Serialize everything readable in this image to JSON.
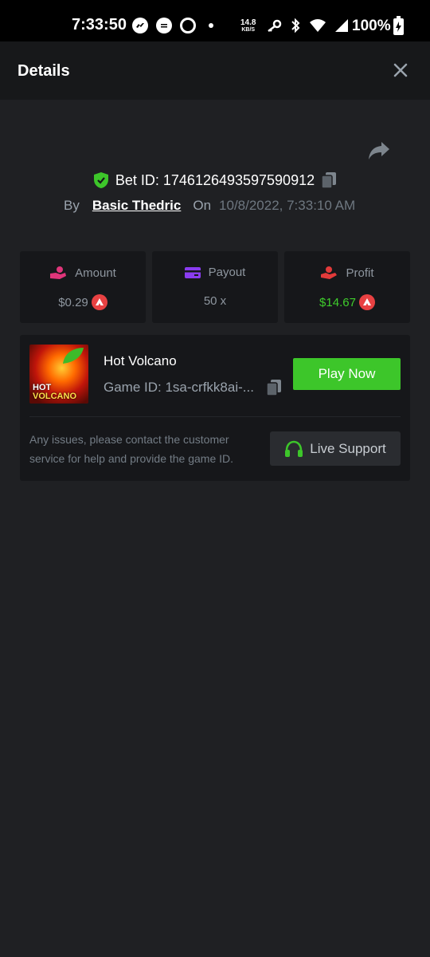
{
  "status_bar": {
    "time": "7:33:50",
    "net_speed_value": "14.8",
    "net_speed_unit": "KB/S",
    "battery": "100%",
    "messenger_icon": "messenger-icon",
    "chat_icon": "chat-bubble-icon",
    "ring_icon": "ring-icon",
    "key_icon": "key-icon",
    "bluetooth_icon": "bluetooth-icon",
    "wifi_icon": "wifi-icon",
    "signal_icon": "signal-icon",
    "battery_icon": "battery-charging-icon"
  },
  "header": {
    "title": "Details",
    "close_icon": "close-icon"
  },
  "bet": {
    "bet_id_text": "Bet ID: 1746126493597590912",
    "by_label": "By",
    "user": "Basic Thedric",
    "on_label": "On",
    "date": "10/8/2022, 7:33:10 AM"
  },
  "stats": {
    "amount": {
      "label": "Amount",
      "value": "$0.29"
    },
    "payout": {
      "label": "Payout",
      "value": "50 x"
    },
    "profit": {
      "label": "Profit",
      "value": "$14.67"
    }
  },
  "game": {
    "title": "Hot Volcano",
    "game_id_text": "Game ID: 1sa-crfkk8ai-...",
    "play_label": "Play Now",
    "thumb_line1": "HOT",
    "thumb_line2": "VOLCANO",
    "help_text": "Any issues, please contact the customer service for help and provide the game ID.",
    "support_label": "Live Support"
  },
  "colors": {
    "accent_green": "#3dc62a",
    "profit_green": "#3fcd2c",
    "coin_red": "#e84142",
    "background": "#1f2023",
    "card": "#16171a"
  }
}
